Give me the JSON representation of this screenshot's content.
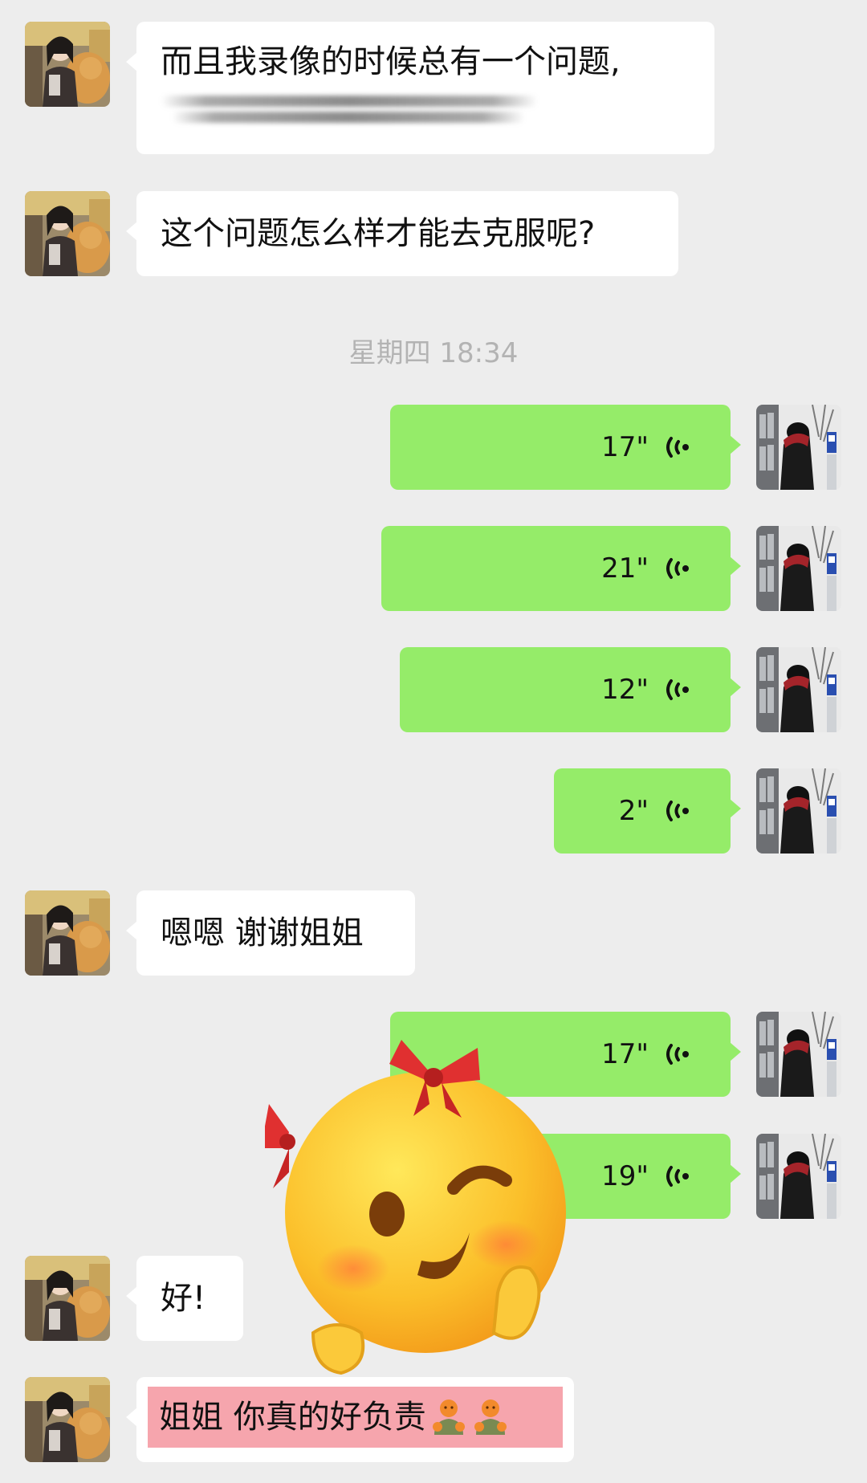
{
  "chat": {
    "timestamp": "星期四 18:34",
    "messages": [
      {
        "from": "other",
        "type": "text",
        "text": "而且我录像的时候总有一个问题,"
      },
      {
        "from": "other",
        "type": "text",
        "text": "这个问题怎么样才能去克服呢?"
      },
      {
        "from": "me",
        "type": "voice",
        "duration": "17\""
      },
      {
        "from": "me",
        "type": "voice",
        "duration": "21\""
      },
      {
        "from": "me",
        "type": "voice",
        "duration": "12\""
      },
      {
        "from": "me",
        "type": "voice",
        "duration": "2\""
      },
      {
        "from": "other",
        "type": "text",
        "text": "嗯嗯 谢谢姐姐"
      },
      {
        "from": "me",
        "type": "voice",
        "duration": "17\""
      },
      {
        "from": "me",
        "type": "voice",
        "duration": "19\""
      },
      {
        "from": "other",
        "type": "text",
        "text": "好!"
      },
      {
        "from": "other",
        "type": "text",
        "text": "姐姐 你真的好负责",
        "highlight_color": "#f6a5ad"
      }
    ]
  },
  "colors": {
    "background": "#ededed",
    "incoming_bubble": "#ffffff",
    "outgoing_bubble": "#95ec69",
    "timestamp_text": "#b3b3b3",
    "highlight": "#f6a5ad"
  },
  "icons": {
    "voice": "voice-wave-icon",
    "sticker": "winking-face-with-bow-emoji",
    "inline_emoji": "orange-person-emoji"
  }
}
